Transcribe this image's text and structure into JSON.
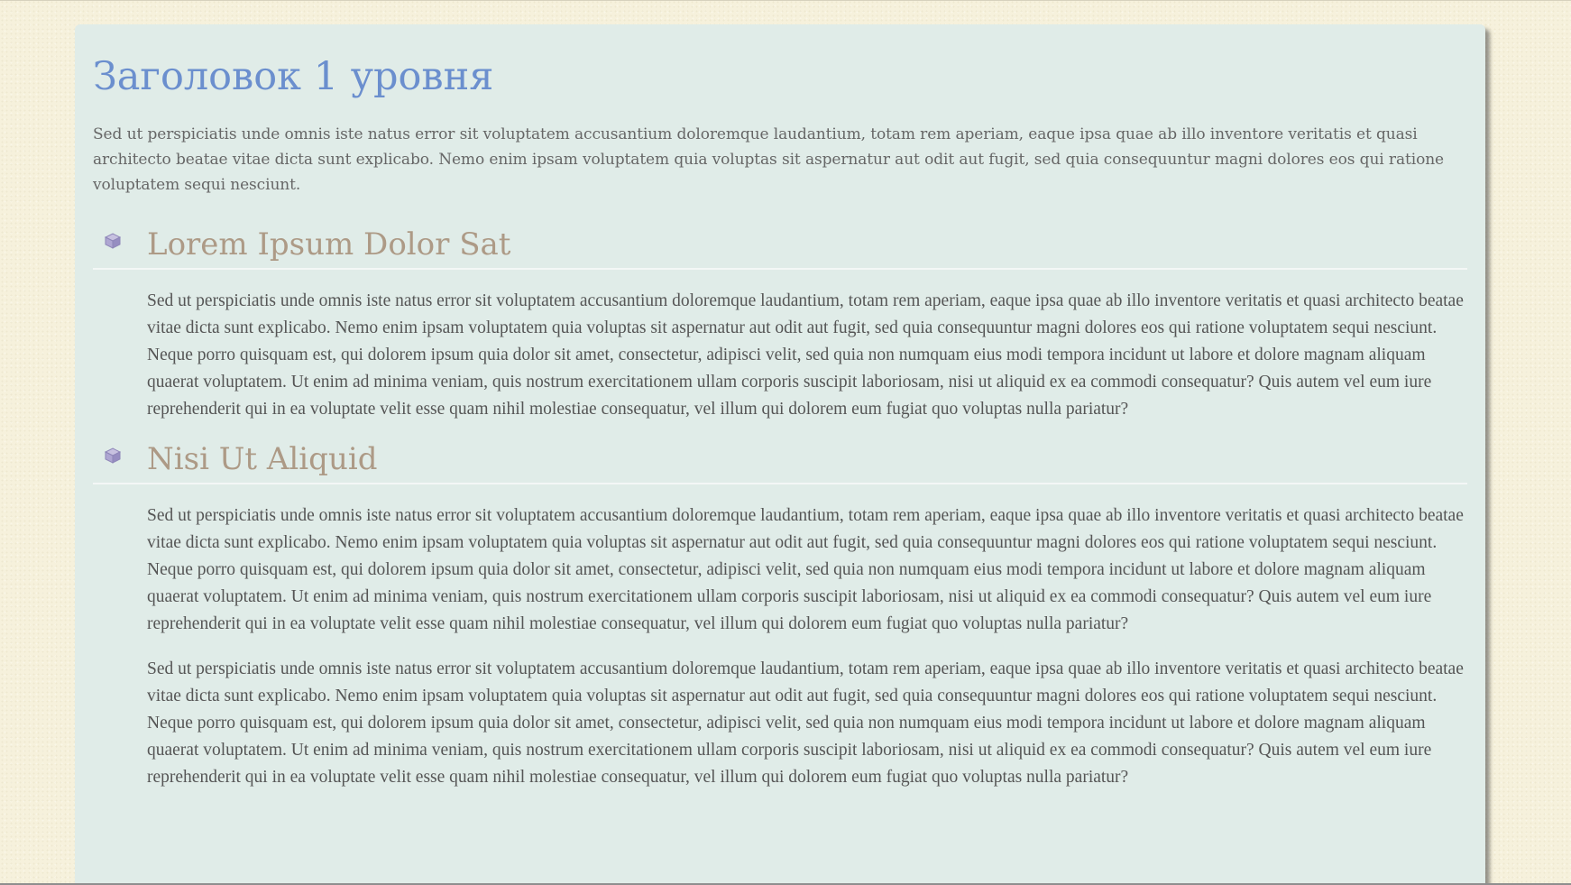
{
  "document": {
    "heading1": "Заголовок 1 уровня",
    "intro": "Sed ut perspiciatis unde omnis iste natus error sit voluptatem accusantium doloremque laudantium, totam rem aperiam, eaque ipsa quae ab illo inventore veritatis et quasi architecto beatae vitae dicta sunt explicabo. Nemo enim ipsam voluptatem quia voluptas sit aspernatur aut odit aut fugit, sed quia consequuntur magni dolores eos qui ratione voluptatem sequi nesciunt.",
    "sections": [
      {
        "icon": "cube-icon",
        "heading": "Lorem Ipsum Dolor Sat",
        "paragraphs": [
          "Sed ut perspiciatis unde omnis iste natus error sit voluptatem accusantium doloremque laudantium, totam rem aperiam, eaque ipsa quae ab illo inventore veritatis et quasi architecto beatae vitae dicta sunt explicabo. Nemo enim ipsam voluptatem quia voluptas sit aspernatur aut odit aut fugit, sed quia consequuntur magni dolores eos qui ratione voluptatem sequi nesciunt. Neque porro quisquam est, qui dolorem ipsum quia dolor sit amet, consectetur, adipisci velit, sed quia non numquam eius modi tempora incidunt ut labore et dolore magnam aliquam quaerat voluptatem. Ut enim ad minima veniam, quis nostrum exercitationem ullam corporis suscipit laboriosam, nisi ut aliquid ex ea commodi consequatur? Quis autem vel eum iure reprehenderit qui in ea voluptate velit esse quam nihil molestiae consequatur, vel illum qui dolorem eum fugiat quo voluptas nulla pariatur?"
        ]
      },
      {
        "icon": "cube-icon",
        "heading": "Nisi Ut Aliquid",
        "paragraphs": [
          "Sed ut perspiciatis unde omnis iste natus error sit voluptatem accusantium doloremque laudantium, totam rem aperiam, eaque ipsa quae ab illo inventore veritatis et quasi architecto beatae vitae dicta sunt explicabo. Nemo enim ipsam voluptatem quia voluptas sit aspernatur aut odit aut fugit, sed quia consequuntur magni dolores eos qui ratione voluptatem sequi nesciunt. Neque porro quisquam est, qui dolorem ipsum quia dolor sit amet, consectetur, adipisci velit, sed quia non numquam eius modi tempora incidunt ut labore et dolore magnam aliquam quaerat voluptatem. Ut enim ad minima veniam, quis nostrum exercitationem ullam corporis suscipit laboriosam, nisi ut aliquid ex ea commodi consequatur? Quis autem vel eum iure reprehenderit qui in ea voluptate velit esse quam nihil molestiae consequatur, vel illum qui dolorem eum fugiat quo voluptas nulla pariatur?",
          "Sed ut perspiciatis unde omnis iste natus error sit voluptatem accusantium doloremque laudantium, totam rem aperiam, eaque ipsa quae ab illo inventore veritatis et quasi architecto beatae vitae dicta sunt explicabo. Nemo enim ipsam voluptatem quia voluptas sit aspernatur aut odit aut fugit, sed quia consequuntur magni dolores eos qui ratione voluptatem sequi nesciunt. Neque porro quisquam est, qui dolorem ipsum quia dolor sit amet, consectetur, adipisci velit, sed quia non numquam eius modi tempora incidunt ut labore et dolore magnam aliquam quaerat voluptatem. Ut enim ad minima veniam, quis nostrum exercitationem ullam corporis suscipit laboriosam, nisi ut aliquid ex ea commodi consequatur? Quis autem vel eum iure reprehenderit qui in ea voluptate velit esse quam nihil molestiae consequatur, vel illum qui dolorem eum fugiat quo voluptas nulla pariatur?"
        ]
      }
    ]
  },
  "colors": {
    "page_background": "#f6f1dc",
    "card_background": "#e0ece8",
    "heading1": "#6b8fce",
    "heading2": "#ad9a86",
    "body_text": "#555555",
    "icon": "#a79fc9"
  }
}
